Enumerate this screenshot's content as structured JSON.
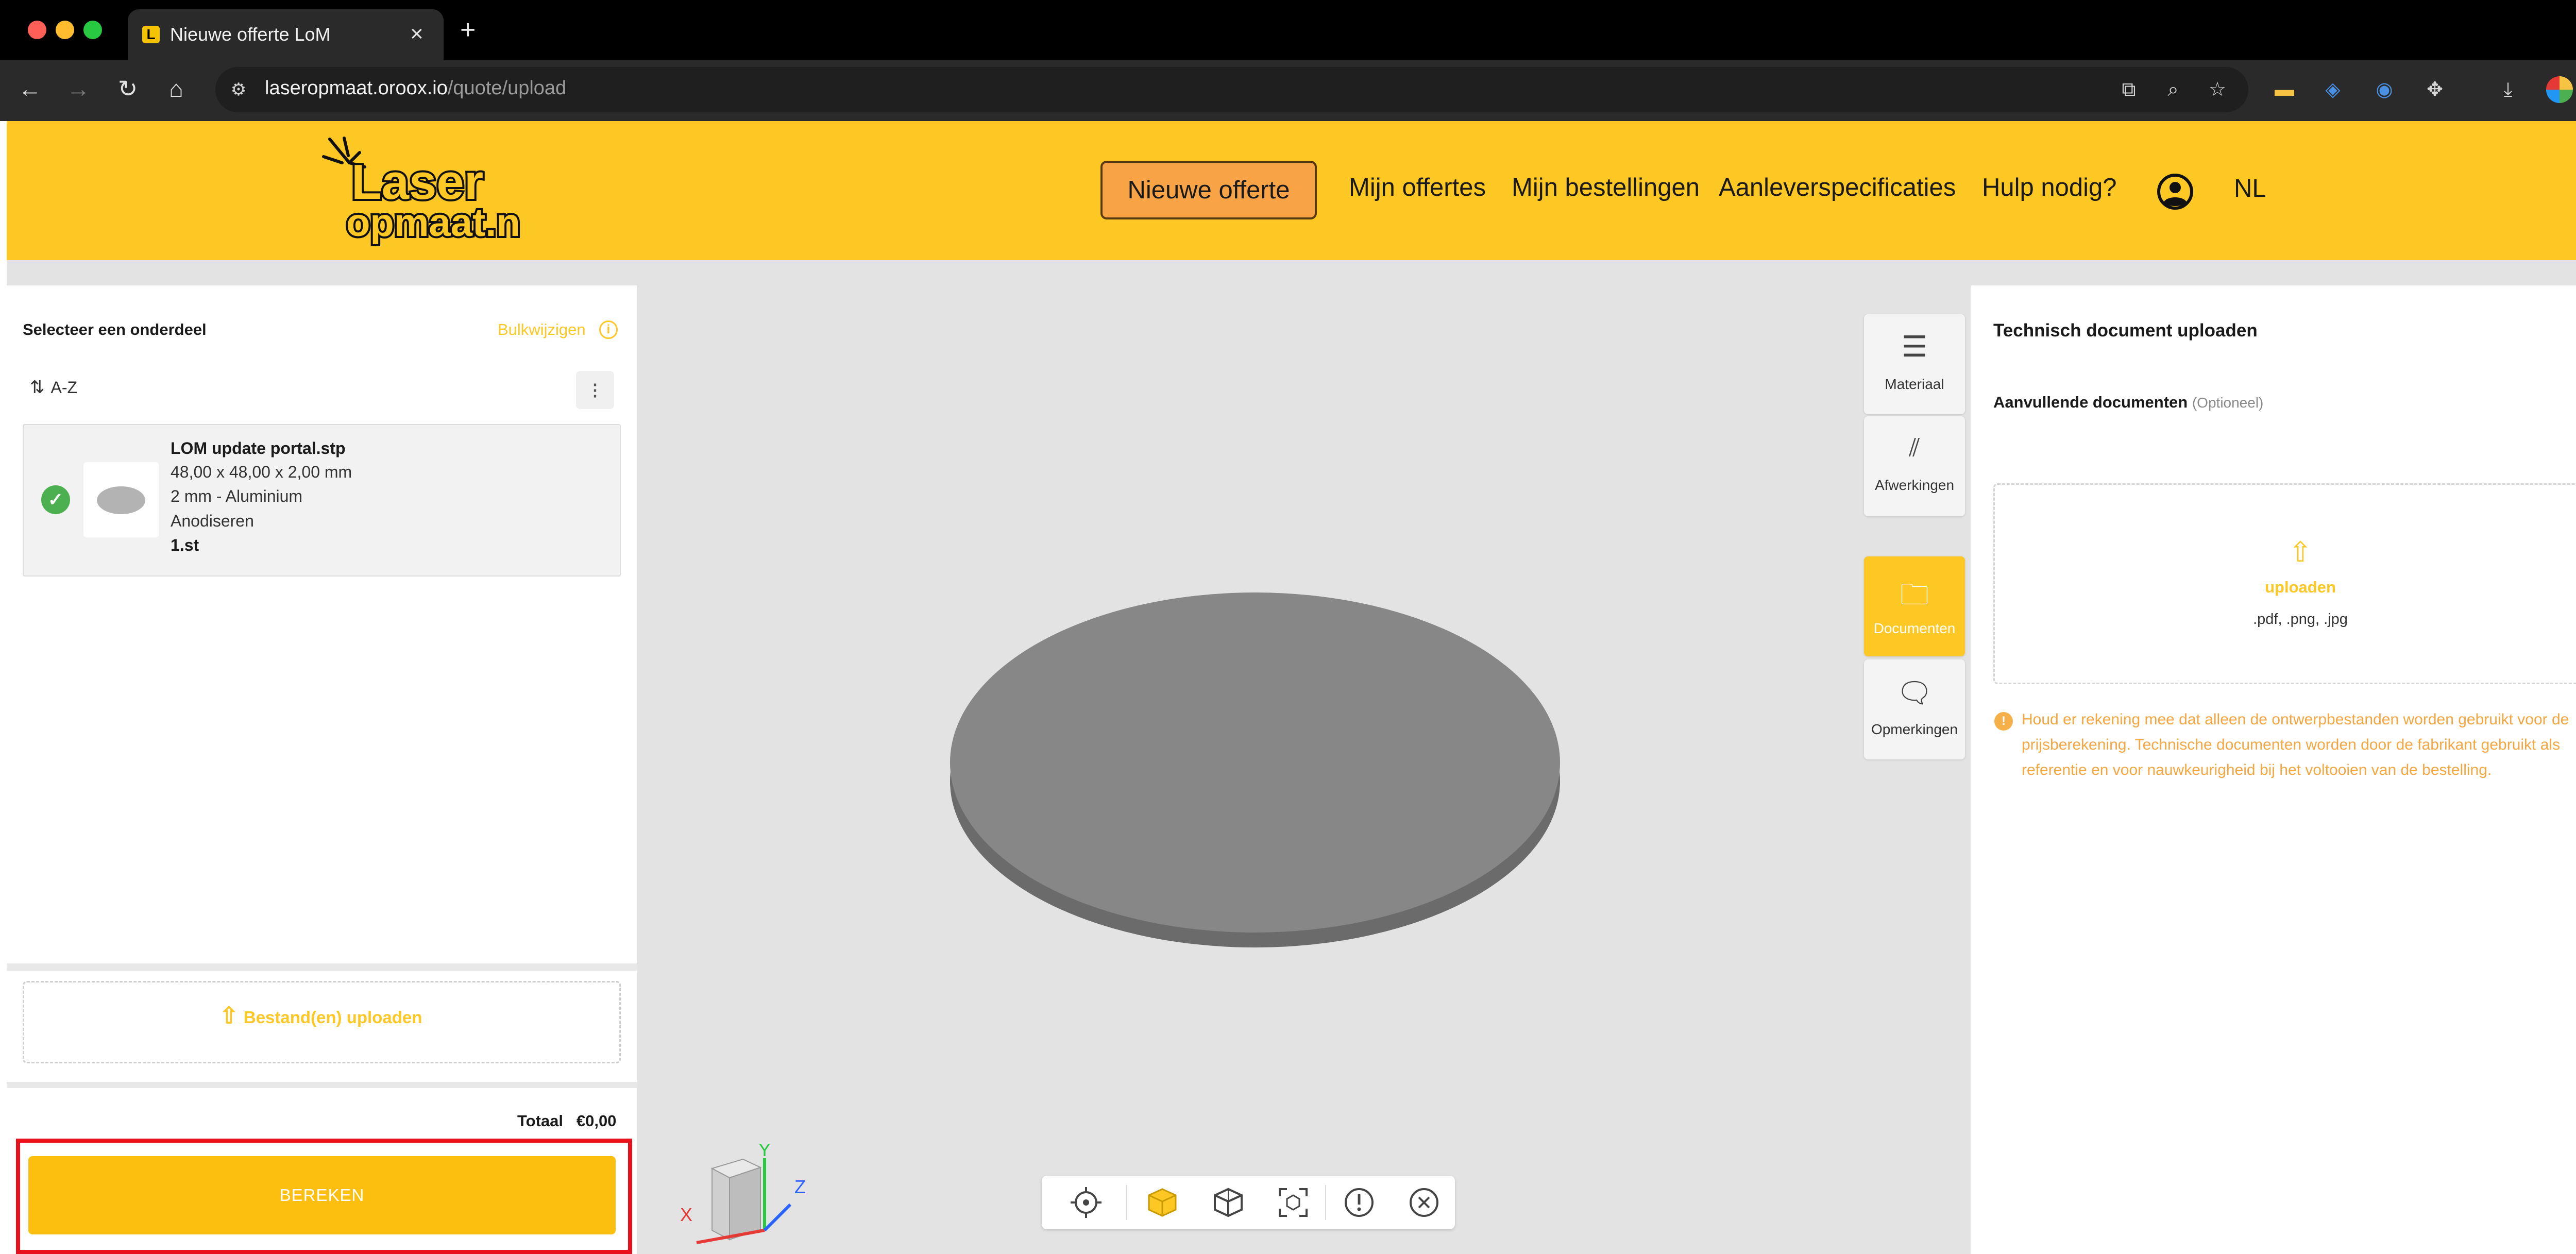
{
  "browser": {
    "tab_title": "Nieuwe offerte LoM",
    "tab_favicon_letter": "L",
    "url_host": "laseropmaat.oroox.io",
    "url_path": "/quote/upload",
    "traffic_light_colors": [
      "#ff5f57",
      "#febc2e",
      "#28c840"
    ]
  },
  "header": {
    "logo_text_top": "Laser",
    "logo_text_bottom": "opmaat.nl",
    "nav": {
      "new_quote": "Nieuwe offerte",
      "my_quotes": "Mijn offertes",
      "my_orders": "Mijn bestellingen",
      "delivery_specs": "Aanleverspecificaties",
      "help": "Hulp nodig?"
    },
    "language": "NL",
    "brand_color": "#fdc724"
  },
  "left_panel": {
    "title": "Selecteer een onderdeel",
    "bulk_edit": "Bulkwijzigen",
    "sort_label": "A-Z",
    "part": {
      "name": "LOM update portal.stp",
      "dimensions": "48,00 x 48,00 x 2,00 mm",
      "material": "2 mm - Aluminium",
      "finish": "Anodiseren",
      "quantity": "1.st"
    },
    "upload_label": "Bestand(en) uploaden",
    "total_label": "Totaal",
    "total_value": "€0,00",
    "calculate_button": "BEREKEN"
  },
  "side_tools": [
    {
      "label": "Materiaal",
      "icon": "menu-lines-icon"
    },
    {
      "label": "Afwerkingen",
      "icon": "hatch-icon"
    },
    {
      "label": "Documenten",
      "icon": "folder-icon"
    },
    {
      "label": "Opmerkingen",
      "icon": "speech-bubble-icon"
    }
  ],
  "viewer": {
    "axis_labels": {
      "x": "X",
      "y": "Y",
      "z": "Z"
    },
    "toolbar_icons": [
      "crosshair-icon",
      "solid-cube-icon",
      "wireframe-cube-icon",
      "fit-view-icon",
      "warning-icon",
      "close-icon"
    ]
  },
  "right_panel": {
    "title": "Technisch document uploaden",
    "subtitle": "Aanvullende documenten",
    "subtitle_optional": "(Optioneel)",
    "upload_label": "uploaden",
    "file_types": ".pdf, .png, .jpg",
    "notice": "Houd er rekening mee dat alleen de ontwerpbestanden worden gebruikt voor de prijsberekening. Technische documenten worden door de fabrikant gebruikt als referentie en voor nauwkeurigheid bij het voltooien van de bestelling."
  }
}
